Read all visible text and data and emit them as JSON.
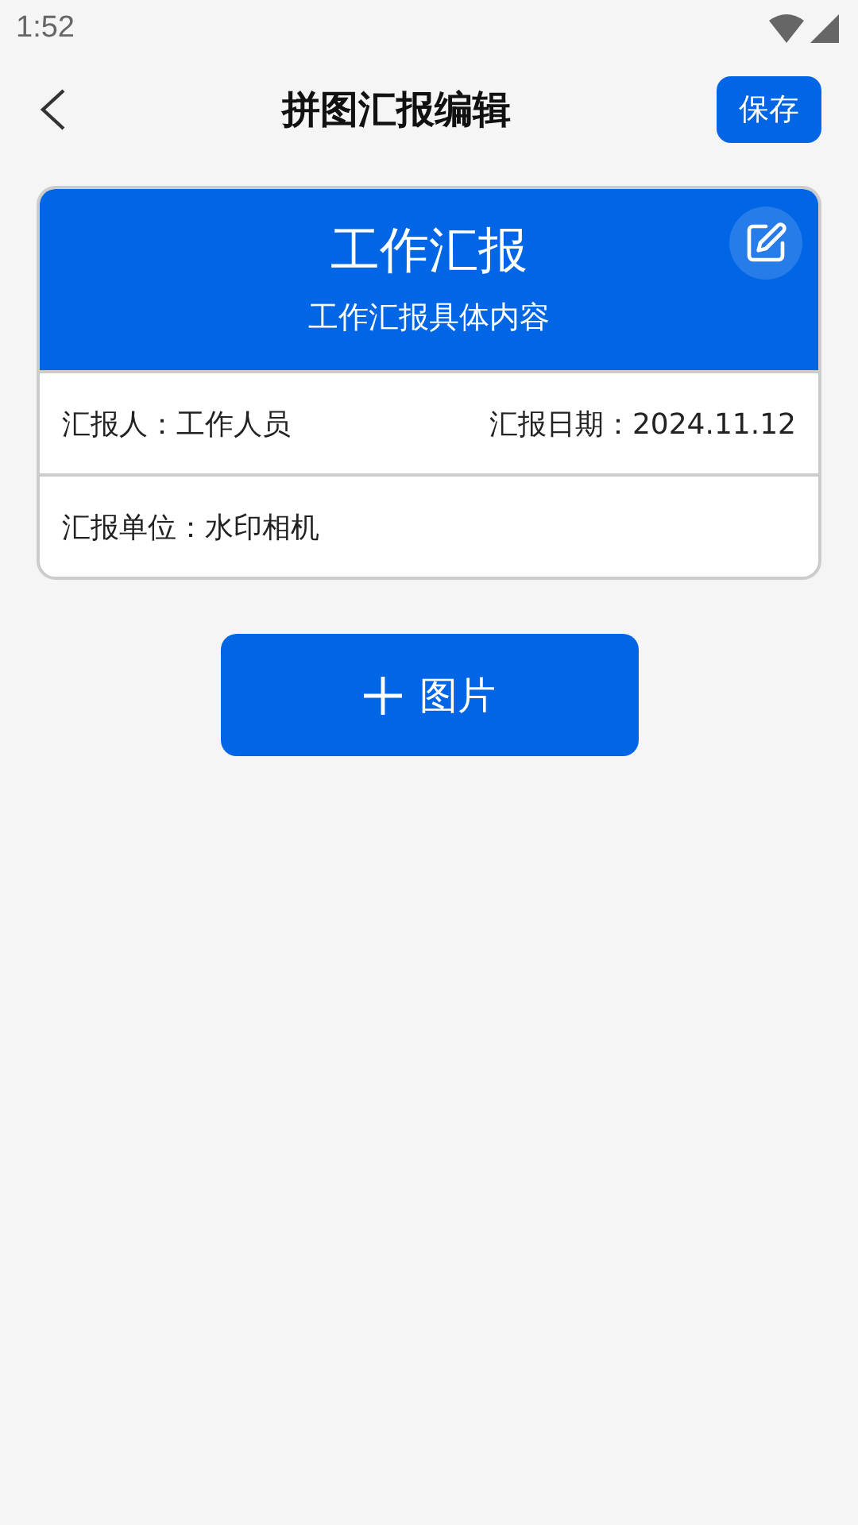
{
  "status_bar": {
    "time": "1:52"
  },
  "header": {
    "title": "拼图汇报编辑",
    "save_label": "保存"
  },
  "report_card": {
    "title": "工作汇报",
    "subtitle": "工作汇报具体内容",
    "rows": [
      [
        {
          "label": "汇报人：工作人员"
        },
        {
          "label": "汇报日期：2024.11.12"
        }
      ],
      [
        {
          "label": "汇报单位：水印相机"
        }
      ]
    ]
  },
  "add_button": {
    "label": "图片"
  }
}
